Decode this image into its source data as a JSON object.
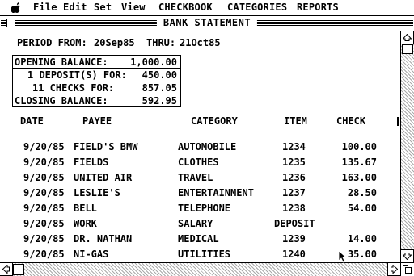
{
  "menubar": {
    "apple_icon": "apple-logo",
    "items": [
      "File",
      "Edit",
      "Set",
      "View",
      "CHECKBOOK",
      "CATEGORIES",
      "REPORTS"
    ]
  },
  "window": {
    "title": "BANK STATEMENT"
  },
  "period": {
    "from_label": "PERIOD FROM:",
    "from_value": "20Sep85",
    "thru_label": "THRU:",
    "thru_value": "21Oct85"
  },
  "summary": {
    "rows": [
      {
        "label": "OPENING BALANCE:",
        "value": "1,000.00"
      },
      {
        "label": "1 DEPOSIT(S) FOR:",
        "value": "450.00"
      },
      {
        "label": "11 CHECKS FOR:",
        "value": "857.05"
      },
      {
        "label": "CLOSING BALANCE:",
        "value": "592.95"
      }
    ]
  },
  "table": {
    "headers": {
      "date": "DATE",
      "payee": "PAYEE",
      "category": "CATEGORY",
      "item": "ITEM",
      "check": "CHECK"
    },
    "rows": [
      {
        "date": "9/20/85",
        "payee": "FIELD'S BMW",
        "category": "AUTOMOBILE",
        "item": "1234",
        "check": "100.00"
      },
      {
        "date": "9/20/85",
        "payee": "FIELDS",
        "category": "CLOTHES",
        "item": "1235",
        "check": "135.67"
      },
      {
        "date": "9/20/85",
        "payee": "UNITED AIR",
        "category": "TRAVEL",
        "item": "1236",
        "check": "163.00"
      },
      {
        "date": "9/20/85",
        "payee": "LESLIE'S",
        "category": "ENTERTAINMENT",
        "item": "1237",
        "check": "28.50"
      },
      {
        "date": "9/20/85",
        "payee": "BELL",
        "category": "TELEPHONE",
        "item": "1238",
        "check": "54.00"
      },
      {
        "date": "9/20/85",
        "payee": "WORK",
        "category": "SALARY",
        "item": "DEPOSIT",
        "check": ""
      },
      {
        "date": "9/20/85",
        "payee": "DR. NATHAN",
        "category": "MEDICAL",
        "item": "1239",
        "check": "14.00"
      },
      {
        "date": "9/20/85",
        "payee": "NI-GAS",
        "category": "UTILITIES",
        "item": "1240",
        "check": "35.00"
      }
    ]
  },
  "colors": {
    "foreground": "#000000",
    "background": "#ffffff"
  }
}
